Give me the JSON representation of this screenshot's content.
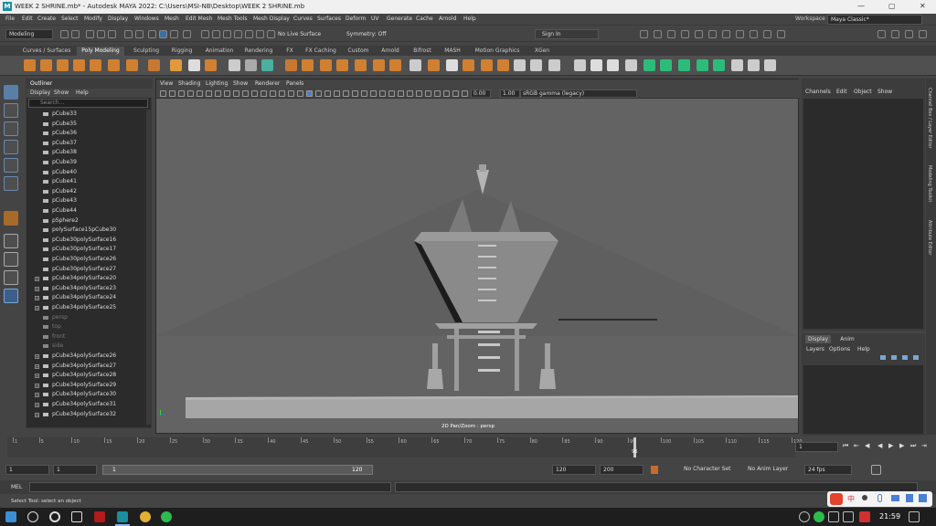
{
  "window": {
    "title": "WEEK 2 SHRINE.mb* - Autodesk MAYA 2022: C:\\Users\\MSI-NB\\Desktop\\WEEK 2 SHRINE.mb",
    "logo": "M"
  },
  "menu": [
    "File",
    "Edit",
    "Create",
    "Select",
    "Modify",
    "Display",
    "Windows",
    "Mesh",
    "Edit Mesh",
    "Mesh Tools",
    "Mesh Display",
    "Curves",
    "Surfaces",
    "Deform",
    "UV",
    "Generate",
    "Cache",
    "Arnold",
    "Help"
  ],
  "workspace": {
    "label": "Workspace :",
    "value": "Maya Classic*"
  },
  "status": {
    "mode": "Modeling",
    "live_surface": "No Live Surface",
    "symmetry": "Symmetry: Off",
    "sign_in": "Sign In"
  },
  "shelf_tabs": [
    "Curves / Surfaces",
    "Poly Modeling",
    "Sculpting",
    "Rigging",
    "Animation",
    "Rendering",
    "FX",
    "FX Caching",
    "Custom",
    "Arnold",
    "Bifrost",
    "MASH",
    "Motion Graphics",
    "XGen"
  ],
  "shelf_active": "Poly Modeling",
  "outliner": {
    "title": "Outliner",
    "menu": [
      "Display",
      "Show",
      "Help"
    ],
    "search_placeholder": "Search...",
    "items": [
      {
        "label": "pCube33",
        "type": "mesh",
        "dim": false,
        "exp": false
      },
      {
        "label": "pCube35",
        "type": "mesh",
        "dim": false,
        "exp": false
      },
      {
        "label": "pCube36",
        "type": "mesh",
        "dim": false,
        "exp": false
      },
      {
        "label": "pCube37",
        "type": "mesh",
        "dim": false,
        "exp": false
      },
      {
        "label": "pCube38",
        "type": "mesh",
        "dim": false,
        "exp": false
      },
      {
        "label": "pCube39",
        "type": "mesh",
        "dim": false,
        "exp": false
      },
      {
        "label": "pCube40",
        "type": "mesh",
        "dim": false,
        "exp": false
      },
      {
        "label": "pCube41",
        "type": "mesh",
        "dim": false,
        "exp": false
      },
      {
        "label": "pCube42",
        "type": "mesh",
        "dim": false,
        "exp": false
      },
      {
        "label": "pCube43",
        "type": "mesh",
        "dim": false,
        "exp": false
      },
      {
        "label": "pCube44",
        "type": "mesh",
        "dim": false,
        "exp": false
      },
      {
        "label": "pSphere2",
        "type": "mesh",
        "dim": false,
        "exp": false
      },
      {
        "label": "polySurface15pCube30",
        "type": "mesh",
        "dim": false,
        "exp": false
      },
      {
        "label": "pCube30polySurface16",
        "type": "mesh",
        "dim": false,
        "exp": false
      },
      {
        "label": "pCube30polySurface17",
        "type": "mesh",
        "dim": false,
        "exp": false
      },
      {
        "label": "pCube30polySurface26",
        "type": "mesh",
        "dim": false,
        "exp": false
      },
      {
        "label": "pCube30polySurface27",
        "type": "mesh",
        "dim": false,
        "exp": false
      },
      {
        "label": "pCube34polySurface20",
        "type": "group",
        "dim": false,
        "exp": true
      },
      {
        "label": "pCube34polySurface23",
        "type": "group",
        "dim": false,
        "exp": true
      },
      {
        "label": "pCube34polySurface24",
        "type": "group",
        "dim": false,
        "exp": true
      },
      {
        "label": "pCube34polySurface25",
        "type": "group",
        "dim": false,
        "exp": true
      },
      {
        "label": "persp",
        "type": "camera",
        "dim": true,
        "exp": false
      },
      {
        "label": "top",
        "type": "camera",
        "dim": true,
        "exp": false
      },
      {
        "label": "front",
        "type": "camera",
        "dim": true,
        "exp": false
      },
      {
        "label": "side",
        "type": "camera",
        "dim": true,
        "exp": false
      },
      {
        "label": "pCube34polySurface26",
        "type": "group",
        "dim": false,
        "exp": true
      },
      {
        "label": "pCube34polySurface27",
        "type": "group",
        "dim": false,
        "exp": true
      },
      {
        "label": "pCube34polySurface28",
        "type": "group",
        "dim": false,
        "exp": true
      },
      {
        "label": "pCube34polySurface29",
        "type": "group",
        "dim": false,
        "exp": true
      },
      {
        "label": "pCube34polySurface30",
        "type": "group",
        "dim": false,
        "exp": true
      },
      {
        "label": "pCube34polySurface31",
        "type": "group",
        "dim": false,
        "exp": true
      },
      {
        "label": "pCube34polySurface32",
        "type": "group",
        "dim": false,
        "exp": true
      }
    ]
  },
  "viewport": {
    "menu": [
      "View",
      "Shading",
      "Lighting",
      "Show",
      "Renderer",
      "Panels"
    ],
    "value_a": "0.00",
    "value_b": "1.00",
    "color_space": "sRGB gamma (legacy)",
    "camera_label": "2D Pan/Zoom : persp"
  },
  "channelbox": {
    "menu": [
      "Channels",
      "Edit",
      "Object",
      "Show"
    ]
  },
  "layers": {
    "tabs": [
      "Display",
      "Anim"
    ],
    "menu": [
      "Layers",
      "Options",
      "Help"
    ]
  },
  "side_tabs": [
    "Channel Box / Layer Editor",
    "Modeling Toolkit",
    "Attribute Editor"
  ],
  "timeline": {
    "labels": [
      "1",
      "5",
      "10",
      "15",
      "20",
      "25",
      "30",
      "35",
      "40",
      "45",
      "50",
      "55",
      "60",
      "65",
      "70",
      "75",
      "80",
      "85",
      "90",
      "95",
      "100",
      "105",
      "110",
      "115",
      "120"
    ],
    "range_start": 1,
    "range_end": 120,
    "current": 96,
    "current_label": "96",
    "current_frame_field": "1"
  },
  "range": {
    "start": "1",
    "start2": "1",
    "slider_start": "1",
    "slider_end": "120",
    "end": "120",
    "end2": "200",
    "character": "No Character Set",
    "anim_layer": "No Anim Layer",
    "fps": "24 fps"
  },
  "cmd": {
    "label": "MEL"
  },
  "help_line": "Select Tool: select an object",
  "taskbar": {
    "clock": "21:59",
    "ime": "中"
  }
}
